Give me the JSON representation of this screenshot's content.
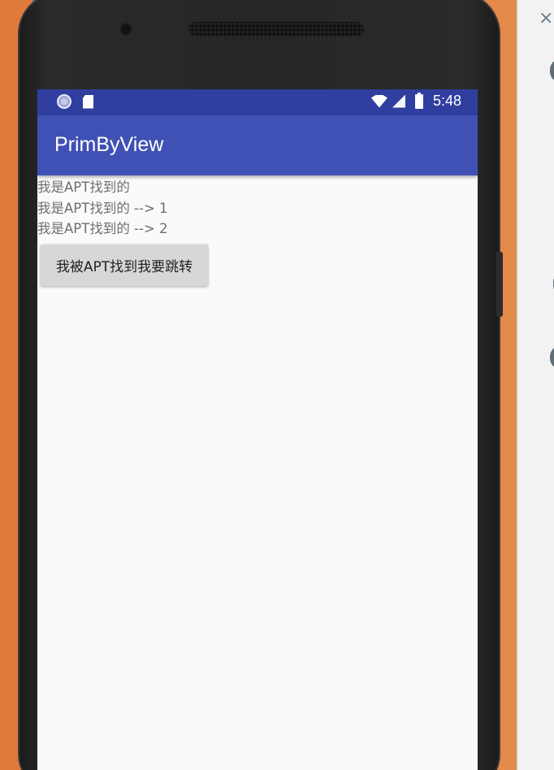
{
  "status_bar": {
    "time": "5:48",
    "icons": [
      "loading-circle-icon",
      "sd-card-icon",
      "wifi-icon",
      "signal-icon",
      "battery-icon"
    ]
  },
  "app_bar": {
    "title": "PrimByView"
  },
  "content": {
    "lines": [
      "我是APT找到的",
      "我是APT找到的 --> 1",
      "我是APT找到的 --> 2"
    ],
    "button_label": "我被APT找到我要跳转"
  },
  "toolbar": {
    "close_symbol": "×"
  },
  "colors": {
    "status_bar": "#303f9f",
    "app_bar": "#3f51b5",
    "background": "#fafafa",
    "button": "#d6d7d7"
  }
}
